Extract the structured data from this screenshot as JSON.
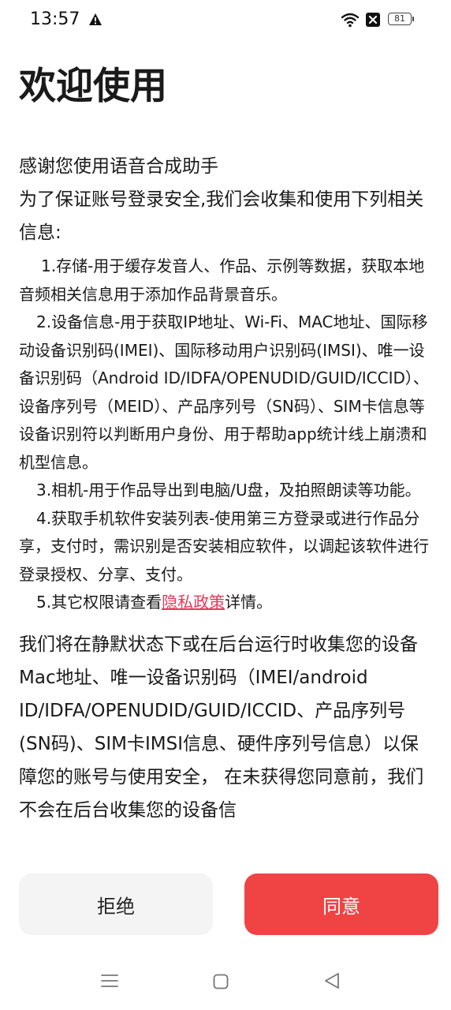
{
  "status_bar": {
    "time": "13:57",
    "battery": "81",
    "icons": [
      "alert-icon",
      "wifi-icon",
      "x-icon",
      "battery-icon"
    ]
  },
  "page": {
    "title": "欢迎使用",
    "intro": [
      "感谢您使用语音合成助手",
      "为了保证账号登录安全,我们会收集和使用下列相关信息:"
    ],
    "permissions": [
      "1.存储-用于缓存发音人、作品、示例等数据，获取本地音频相关信息用于添加作品背景音乐。",
      "2.设备信息-用于获取IP地址、Wi-Fi、MAC地址、国际移动设备识别码(IMEI)、国际移动用户识别码(IMSI)、唯一设备识别码（Android ID/IDFA/OPENUDID/GUID/ICCID）、设备序列号（MEID）、产品序列号（SN码）、SIM卡信息等设备识别符以判断用户身份、用于帮助app统计线上崩溃和机型信息。",
      "3.相机-用于作品导出到电脑/U盘，及拍照朗读等功能。",
      "4.获取手机软件安装列表-使用第三方登录或进行作品分享，支付时，需识别是否安装相应软件，以调起该软件进行登录授权、分享、支付。"
    ],
    "perm5": {
      "before": "5.其它权限请查看",
      "link": "隐私政策",
      "after": "详情。"
    },
    "closing": "我们将在静默状态下或在后台运行时收集您的设备Mac地址、唯一设备识别码（IMEI/android ID/IDFA/OPENUDID/GUID/ICCID、产品序列号(SN码)、SIM卡IMSI信息、硬件序列号信息）以保障您的账号与使用安全， 在未获得您同意前，我们不会在后台收集您的设备信"
  },
  "buttons": {
    "reject": "拒绝",
    "agree": "同意"
  },
  "colors": {
    "agree_bg": "#f04444",
    "reject_bg": "#f4f4f4",
    "link": "#e8375b"
  },
  "nav_bar": {
    "icons": [
      "menu-icon",
      "home-icon",
      "back-icon"
    ]
  }
}
